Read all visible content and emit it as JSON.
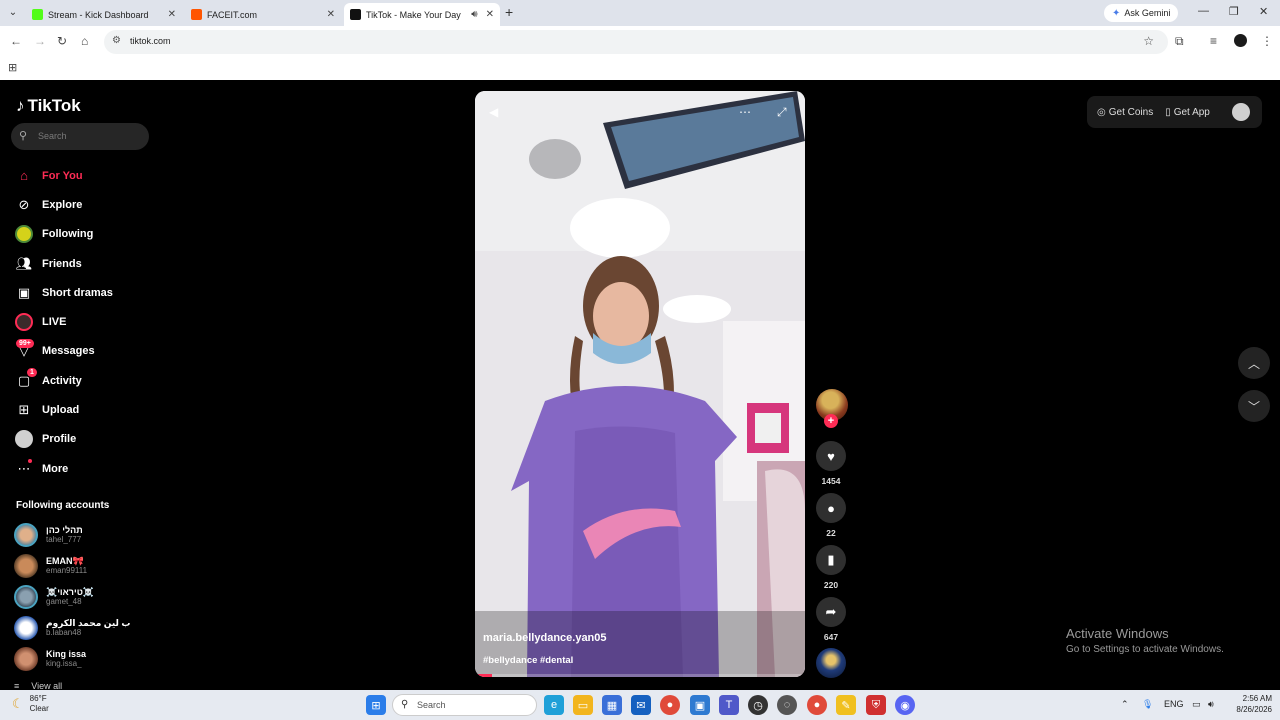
{
  "browser": {
    "tabs": [
      {
        "title": "Stream - Kick Dashboard",
        "favicon_color": "#53fc18"
      },
      {
        "title": "FACEIT.com",
        "favicon_color": "#ff5500"
      },
      {
        "title": "TikTok - Make Your Day",
        "favicon_color": "#111111"
      }
    ],
    "new_tab_icon": "plus-icon",
    "ask_gemini": "Ask Gemini",
    "url": "tiktok.com"
  },
  "tiktok": {
    "logo": "TikTok",
    "search_placeholder": "Search",
    "nav": [
      {
        "label": "For You",
        "icon": "home-icon",
        "active": true
      },
      {
        "label": "Explore",
        "icon": "compass-icon"
      },
      {
        "label": "Following",
        "icon": "following-icon"
      },
      {
        "label": "Friends",
        "icon": "friends-icon"
      },
      {
        "label": "Short dramas",
        "icon": "film-icon"
      },
      {
        "label": "LIVE",
        "icon": "live-icon"
      },
      {
        "label": "Messages",
        "icon": "messages-icon",
        "badge": "99+"
      },
      {
        "label": "Activity",
        "icon": "activity-icon",
        "badge": "1"
      },
      {
        "label": "Upload",
        "icon": "upload-icon"
      },
      {
        "label": "Profile",
        "icon": "profile-icon"
      },
      {
        "label": "More",
        "icon": "more-icon"
      }
    ],
    "following_title": "Following accounts",
    "following": [
      {
        "name": "תהלי כהן",
        "handle": "tahel_777"
      },
      {
        "name": "EMAN🎀",
        "handle": "eman99111"
      },
      {
        "name": "☠️טיראוי☠️",
        "handle": "gamet_48"
      },
      {
        "name": "ب لين محمد الكروم",
        "handle": "b.laban48"
      },
      {
        "name": "King issa",
        "handle": "king.issa_"
      }
    ],
    "view_all": "View all",
    "video": {
      "username": "maria.bellydance.yan05",
      "tags": "#bellydance #dental",
      "progress": 0.05
    },
    "actions": {
      "likes": "1454",
      "comments": "22",
      "saves": "220",
      "shares": "647"
    },
    "top_right": {
      "coins": "Get Coins",
      "app": "Get App"
    }
  },
  "watermark": {
    "line1": "Activate Windows",
    "line2": "Go to Settings to activate Windows."
  },
  "taskbar": {
    "temp": "86°F",
    "condition": "Clear",
    "search": "Search",
    "lang": "ENG",
    "time": "2:56 AM",
    "date": "8/26/2026"
  }
}
